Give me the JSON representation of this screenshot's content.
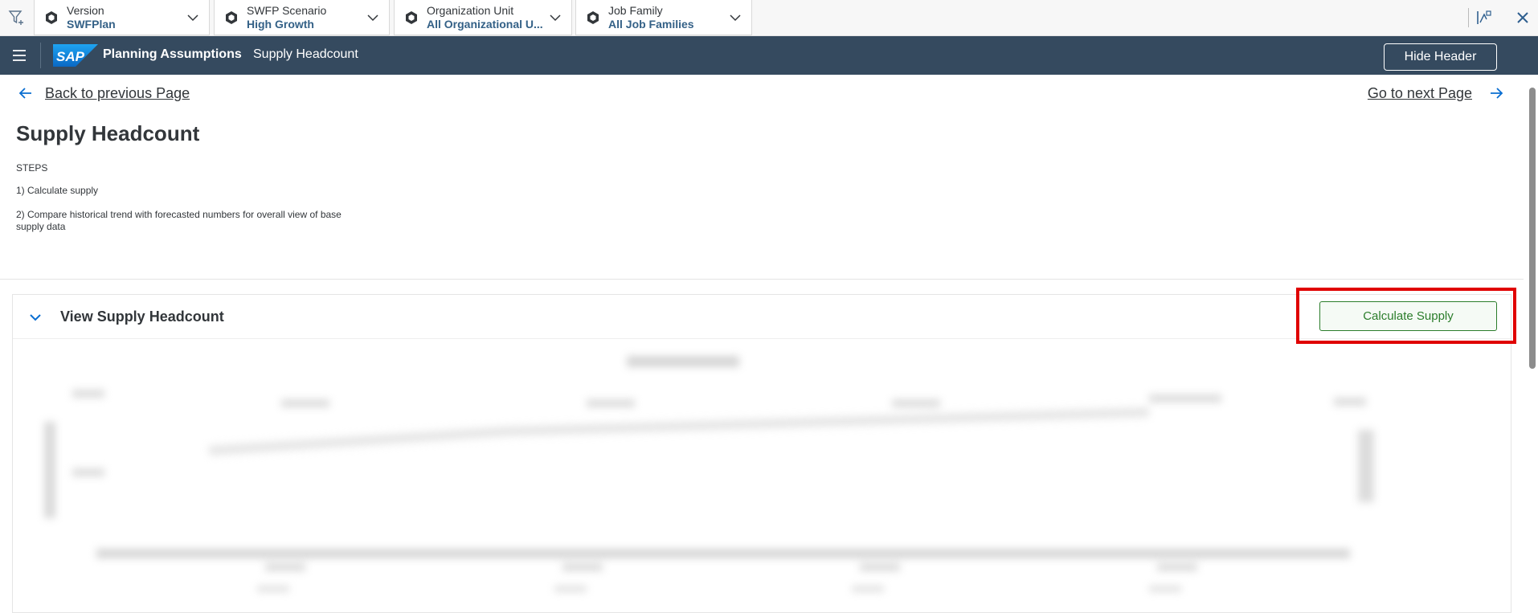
{
  "filterbar": {
    "filters": [
      {
        "label": "Version",
        "value": "SWFPlan"
      },
      {
        "label": "SWFP Scenario",
        "value": "High Growth"
      },
      {
        "label": "Organization Unit",
        "value": "All Organizational U..."
      },
      {
        "label": "Job Family",
        "value": "All Job Families"
      }
    ],
    "icons": {
      "filter": "filter-add-icon",
      "dimension": "cube-icon",
      "chevron": "chevron-down-icon",
      "variable": "variable-icon",
      "close": "close-icon"
    }
  },
  "shell": {
    "logo": "SAP",
    "title": "Planning Assumptions",
    "subtitle": "Supply Headcount",
    "hide_header": "Hide Header",
    "bg_color": "#354a5f"
  },
  "nav": {
    "back": "Back to previous Page",
    "next": "Go to next Page"
  },
  "page": {
    "title": "Supply Headcount",
    "steps_title": "STEPS",
    "steps": [
      "1) Calculate supply",
      "2) Compare historical trend with forecasted numbers for overall view of base supply data"
    ]
  },
  "panel": {
    "title": "View Supply Headcount",
    "calculate_button": "Calculate Supply",
    "accent_color": "#2b7d2b",
    "highlight_color": "#e00000"
  }
}
